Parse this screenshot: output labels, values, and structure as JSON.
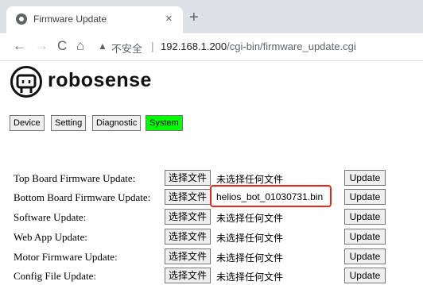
{
  "browser": {
    "tab_title": "Firmware Update",
    "tab_close": "×",
    "new_tab": "+",
    "nav": {
      "back": "←",
      "forward": "→",
      "reload": "C",
      "home": "⌂"
    },
    "security_icon": "▲",
    "security_text": "不安全",
    "separator": "|",
    "url_host": "192.168.1.200",
    "url_path": "/cgi-bin/firmware_update.cgi"
  },
  "logo": {
    "text": "robosense"
  },
  "nav_tabs": [
    {
      "label": "Device",
      "active": false
    },
    {
      "label": "Setting",
      "active": false
    },
    {
      "label": "Diagnostic",
      "active": false
    },
    {
      "label": "System",
      "active": true
    }
  ],
  "rows": [
    {
      "label": "Top Board Firmware Update:",
      "choose": "选择文件",
      "file": "未选择任何文件",
      "update": "Update"
    },
    {
      "label": "Bottom Board Firmware Update:",
      "choose": "选择文件",
      "file": "helios_bot_01030731.bin",
      "update": "Update"
    },
    {
      "label": "Software Update:",
      "choose": "选择文件",
      "file": "未选择任何文件",
      "update": "Update"
    },
    {
      "label": "Web App Update:",
      "choose": "选择文件",
      "file": "未选择任何文件",
      "update": "Update"
    },
    {
      "label": "Motor Firmware Update:",
      "choose": "选择文件",
      "file": "未选择任何文件",
      "update": "Update"
    },
    {
      "label": "Config File Update:",
      "choose": "选择文件",
      "file": "未选择任何文件",
      "update": "Update"
    }
  ],
  "colors": {
    "active_tab": "#00ff00",
    "highlight": "#e5281c",
    "tabstrip": "#dee1e6"
  }
}
